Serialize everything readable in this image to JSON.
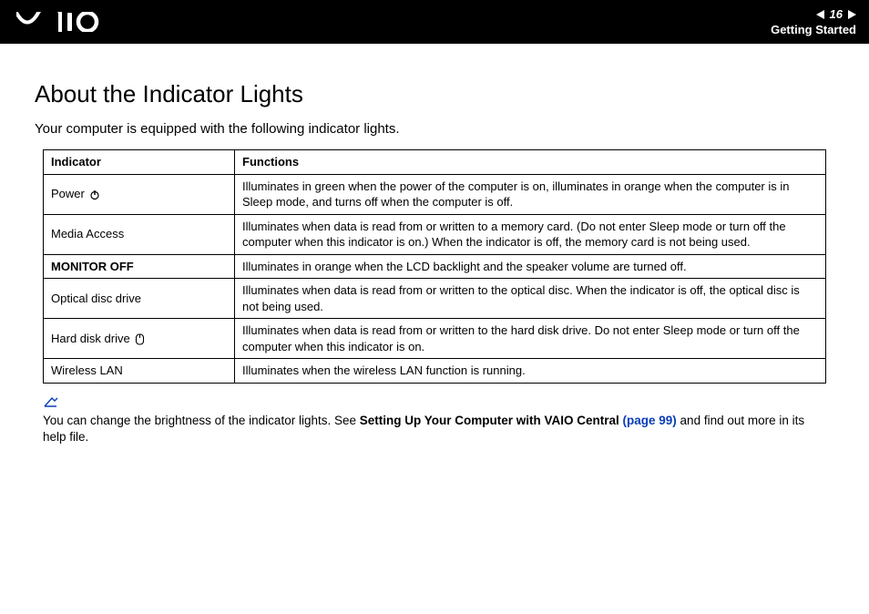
{
  "header": {
    "page_number": "16",
    "section": "Getting Started"
  },
  "page": {
    "title": "About the Indicator Lights",
    "intro": "Your computer is equipped with the following indicator lights."
  },
  "table": {
    "headers": {
      "indicator": "Indicator",
      "functions": "Functions"
    },
    "rows": [
      {
        "indicator": "Power",
        "icon": "power-icon",
        "bold": false,
        "functions": "Illuminates in green when the power of the computer is on, illuminates in orange when the computer is in Sleep mode, and turns off when the computer is off."
      },
      {
        "indicator": "Media Access",
        "icon": null,
        "bold": false,
        "functions": "Illuminates when data is read from or written to a memory card. (Do not enter Sleep mode or turn off the computer when this indicator is on.) When the indicator is off, the memory card is not being used."
      },
      {
        "indicator": "MONITOR OFF",
        "icon": null,
        "bold": true,
        "functions": "Illuminates in orange when the LCD backlight and the speaker volume are turned off."
      },
      {
        "indicator": "Optical disc drive",
        "icon": null,
        "bold": false,
        "functions": "Illuminates when data is read from or written to the optical disc. When the indicator is off, the optical disc is not being used."
      },
      {
        "indicator": "Hard disk drive",
        "icon": "disk-icon",
        "bold": false,
        "functions": "Illuminates when data is read from or written to the hard disk drive. Do not enter Sleep mode or turn off the computer when this indicator is on."
      },
      {
        "indicator": "Wireless LAN",
        "icon": null,
        "bold": false,
        "functions": "Illuminates when the wireless LAN function is running."
      }
    ]
  },
  "note": {
    "pre": "You can change the brightness of the indicator lights. See ",
    "strong": "Setting Up Your Computer with VAIO Central ",
    "link": "(page 99)",
    "post": " and find out more in its help file."
  }
}
